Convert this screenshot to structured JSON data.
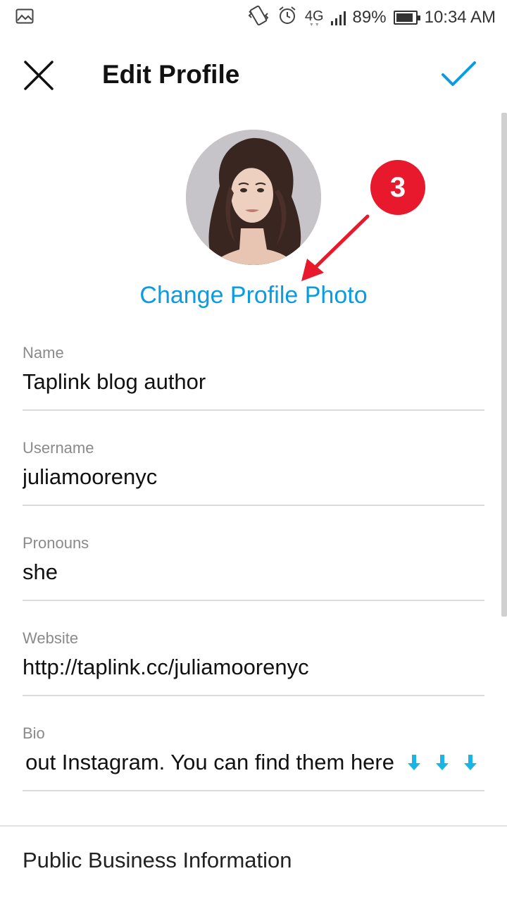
{
  "status_bar": {
    "network": "4G",
    "battery": "89%",
    "battery_level": 0.89,
    "time": "10:34 AM",
    "icons": [
      "image-icon",
      "vibrate-icon",
      "alarm-icon",
      "signal-icon",
      "battery-icon"
    ]
  },
  "header": {
    "title": "Edit Profile",
    "close_icon": "close-icon",
    "confirm_icon": "check-icon"
  },
  "profile": {
    "change_photo_label": "Change Profile Photo",
    "step_number": "3"
  },
  "fields": {
    "name": {
      "label": "Name",
      "value": "Taplink blog author"
    },
    "username": {
      "label": "Username",
      "value": "juliamoorenyc"
    },
    "pronouns": {
      "label": "Pronouns",
      "value": "she"
    },
    "website": {
      "label": "Website",
      "value": "http://taplink.cc/juliamoorenyc"
    },
    "bio": {
      "label": "Bio",
      "value": "out Instagram. You can find them here"
    }
  },
  "sections": {
    "public_business_info": "Public Business Information"
  },
  "colors": {
    "accent": "#0a9be0",
    "annotation": "#e8192c",
    "bio_arrows": "#19b5e6"
  }
}
